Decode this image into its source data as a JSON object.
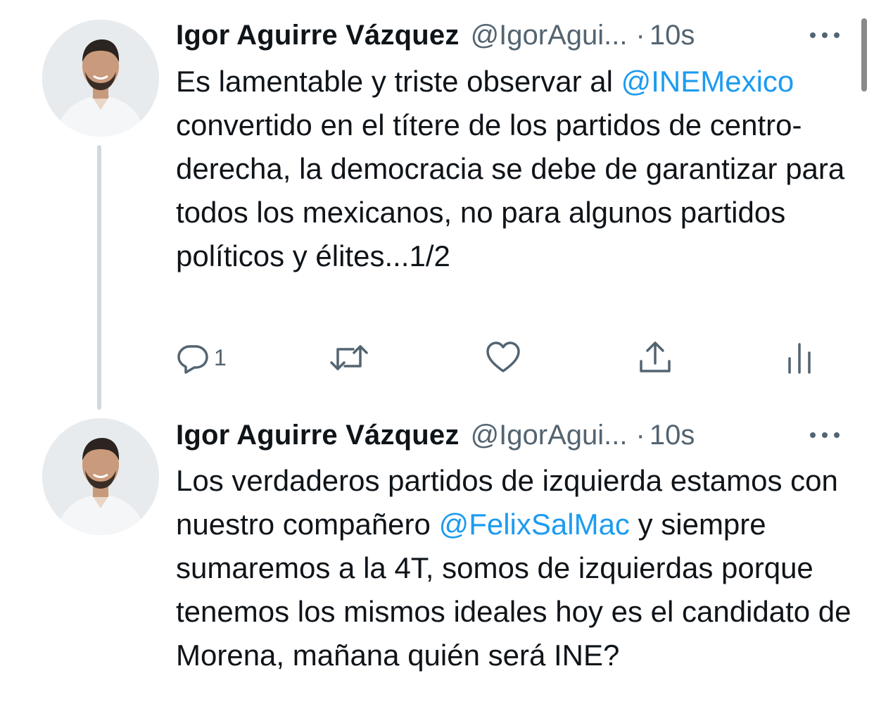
{
  "colors": {
    "link": "#1d9bf0",
    "secondary_text": "#536471",
    "thread_line": "#cfd9de"
  },
  "tweets": [
    {
      "author_name": "Igor Aguirre Vázquez",
      "handle": "@IgorAgui...",
      "separator": "·",
      "time": "10s",
      "text_parts": [
        "Es lamentable y triste observar al ",
        "@INEMexico",
        " convertido en el títere de los partidos de centro-derecha, la democracia se debe de garantizar para todos los mexicanos, no para algunos partidos políticos y élites...1/2"
      ],
      "reply_count": "1",
      "icons": [
        "reply-icon",
        "retweet-icon",
        "like-icon",
        "share-icon",
        "analytics-icon"
      ]
    },
    {
      "author_name": "Igor Aguirre Vázquez",
      "handle": "@IgorAgui...",
      "separator": "·",
      "time": "10s",
      "text_parts": [
        "Los verdaderos partidos de izquierda estamos con nuestro compañero ",
        "@FelixSalMac",
        " y siempre sumaremos a la 4T, somos de izquierdas porque tenemos los mismos ideales hoy es el candidato de Morena, mañana quién será INE?"
      ]
    }
  ]
}
